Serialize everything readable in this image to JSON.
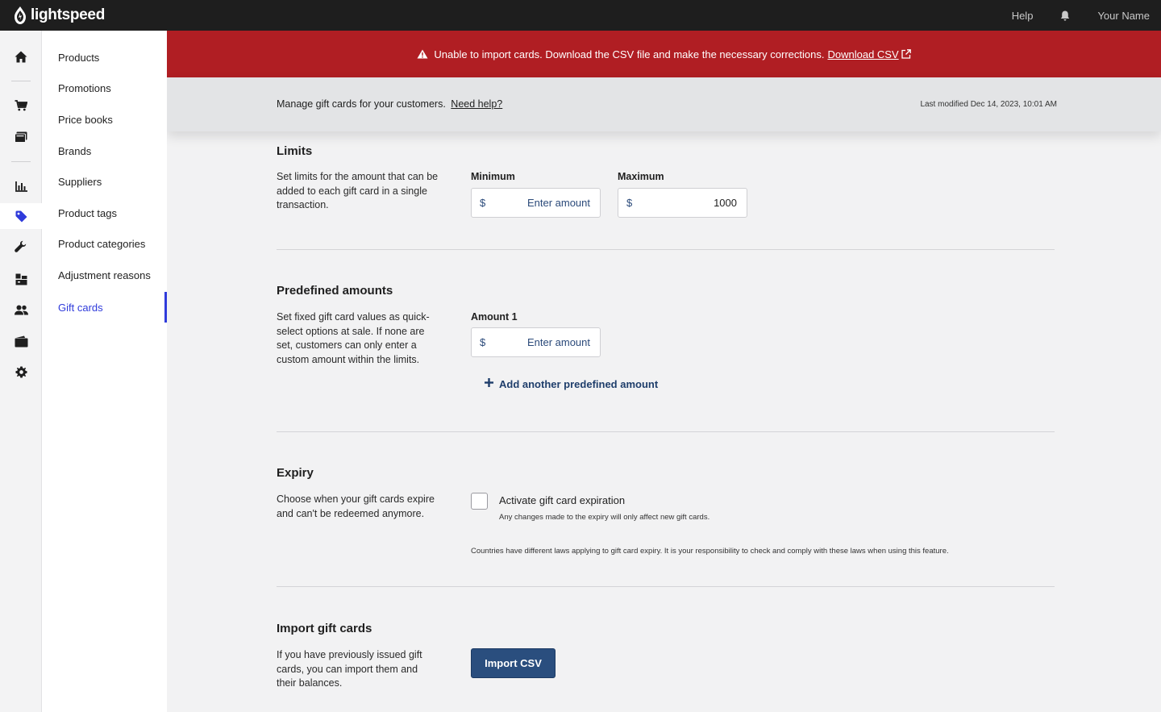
{
  "topbar": {
    "brand": "lightspeed",
    "help_label": "Help",
    "user_name": "Your Name"
  },
  "rail": {
    "icons": [
      "home-icon",
      "cart-icon",
      "register-icon",
      "reports-icon",
      "tag-icon",
      "wrench-icon",
      "inventory-icon",
      "customers-icon",
      "wallet-icon",
      "settings-icon"
    ],
    "active_icon": "tag-icon",
    "accent_color": "#2f3bdb"
  },
  "subnav": {
    "items": [
      {
        "label": "Products"
      },
      {
        "label": "Promotions"
      },
      {
        "label": "Price books"
      },
      {
        "label": "Brands"
      },
      {
        "label": "Suppliers"
      },
      {
        "label": "Product tags"
      },
      {
        "label": "Product categories"
      },
      {
        "label": "Adjustment reasons"
      },
      {
        "label": "Gift cards"
      }
    ],
    "active": "Gift cards"
  },
  "banner": {
    "message": "Unable to import cards. Download the CSV file and make the necessary corrections.",
    "link_label": "Download CSV",
    "color": "#b01e23"
  },
  "info": {
    "manage_text": "Manage gift cards for your customers.",
    "help_link": "Need help?",
    "last_modified": "Last modified Dec 14, 2023, 10:01 AM"
  },
  "limits": {
    "title": "Limits",
    "description": "Set limits for the amount that can be added to each gift card in a single transaction.",
    "minimum": {
      "label": "Minimum",
      "currency": "$",
      "placeholder": "Enter amount",
      "value": ""
    },
    "maximum": {
      "label": "Maximum",
      "currency": "$",
      "placeholder": "",
      "value": "1000"
    }
  },
  "predefined": {
    "title": "Predefined amounts",
    "description": "Set fixed gift card values as quick-select options at sale. If none are set, customers can only enter a custom amount within the limits.",
    "amount1": {
      "label": "Amount 1",
      "currency": "$",
      "placeholder": "Enter amount",
      "value": ""
    },
    "add_label": "Add another predefined amount"
  },
  "expiry": {
    "title": "Expiry",
    "description": "Choose when your gift cards expire and can't be redeemed anymore.",
    "checkbox_label": "Activate gift card expiration",
    "checked": false,
    "note": "Any changes made to the expiry will only affect new gift cards.",
    "legal": "Countries have different laws applying to gift card expiry. It is your responsibility to check and comply with these laws when using this feature."
  },
  "import": {
    "title": "Import gift cards",
    "description": "If you have previously issued gift cards, you can import them and their balances.",
    "button_label": "Import CSV",
    "button_color": "#2a4e7e"
  }
}
